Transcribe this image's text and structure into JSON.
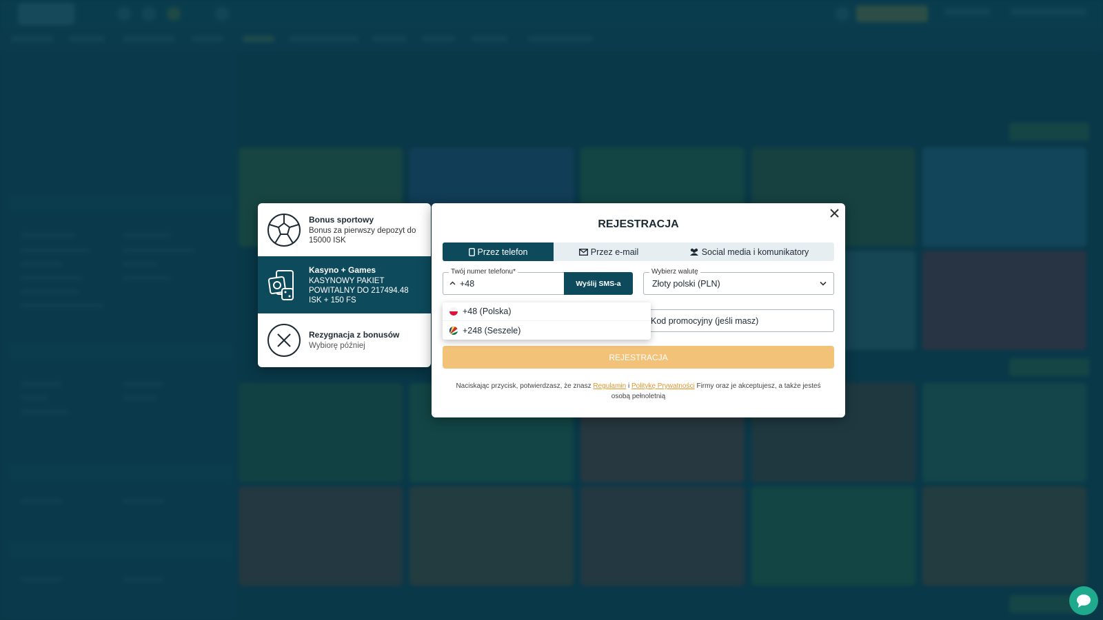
{
  "bonus": {
    "sport": {
      "title": "Bonus sportowy",
      "desc": "Bonus za pierwszy depozyt do 15000 ISK"
    },
    "casino": {
      "title": "Kasyno + Games",
      "desc": "KASYNOWY PAKIET POWITALNY DO 217494.48 ISK + 150 FS"
    },
    "none": {
      "title": "Rezygnacja z bonusów",
      "desc": "Wybiorę później"
    }
  },
  "modal": {
    "title": "REJESTRACJA",
    "tabs": [
      {
        "label": "Przez telefon"
      },
      {
        "label": "Przez e-mail"
      },
      {
        "label": "Social media i komunikatory"
      }
    ],
    "phone": {
      "label": "Twój numer telefonu",
      "required_mark": "*",
      "value": "+48"
    },
    "sms_button": "Wyślij SMS-a",
    "currency": {
      "label": "Wybierz walutę",
      "value": "Złoty polski (PLN)"
    },
    "promo": {
      "placeholder": "Kod promocyjny (jeśli masz)"
    },
    "dropdown": [
      {
        "label": "+48 (Polska)"
      },
      {
        "label": "+248 (Seszele)"
      }
    ],
    "submit": "REJESTRACJA",
    "legal": {
      "part1": "Naciskając przycisk, potwierdzasz, że znasz ",
      "link1": "Regulamin",
      "part2": " i ",
      "link2": "Politykę Prywatności",
      "part3": " Firmy oraz je akceptujesz, a także jesteś osobą pełnoletnią"
    }
  },
  "colors": {
    "primary": "#0d4a5c",
    "accent": "#f3c279",
    "link": "#e0962a",
    "chat": "#1fa98d"
  },
  "icons": {
    "close": "close-icon",
    "phone": "phone-icon",
    "mail": "mail-icon",
    "users": "users-icon",
    "chat": "chat-icon"
  }
}
